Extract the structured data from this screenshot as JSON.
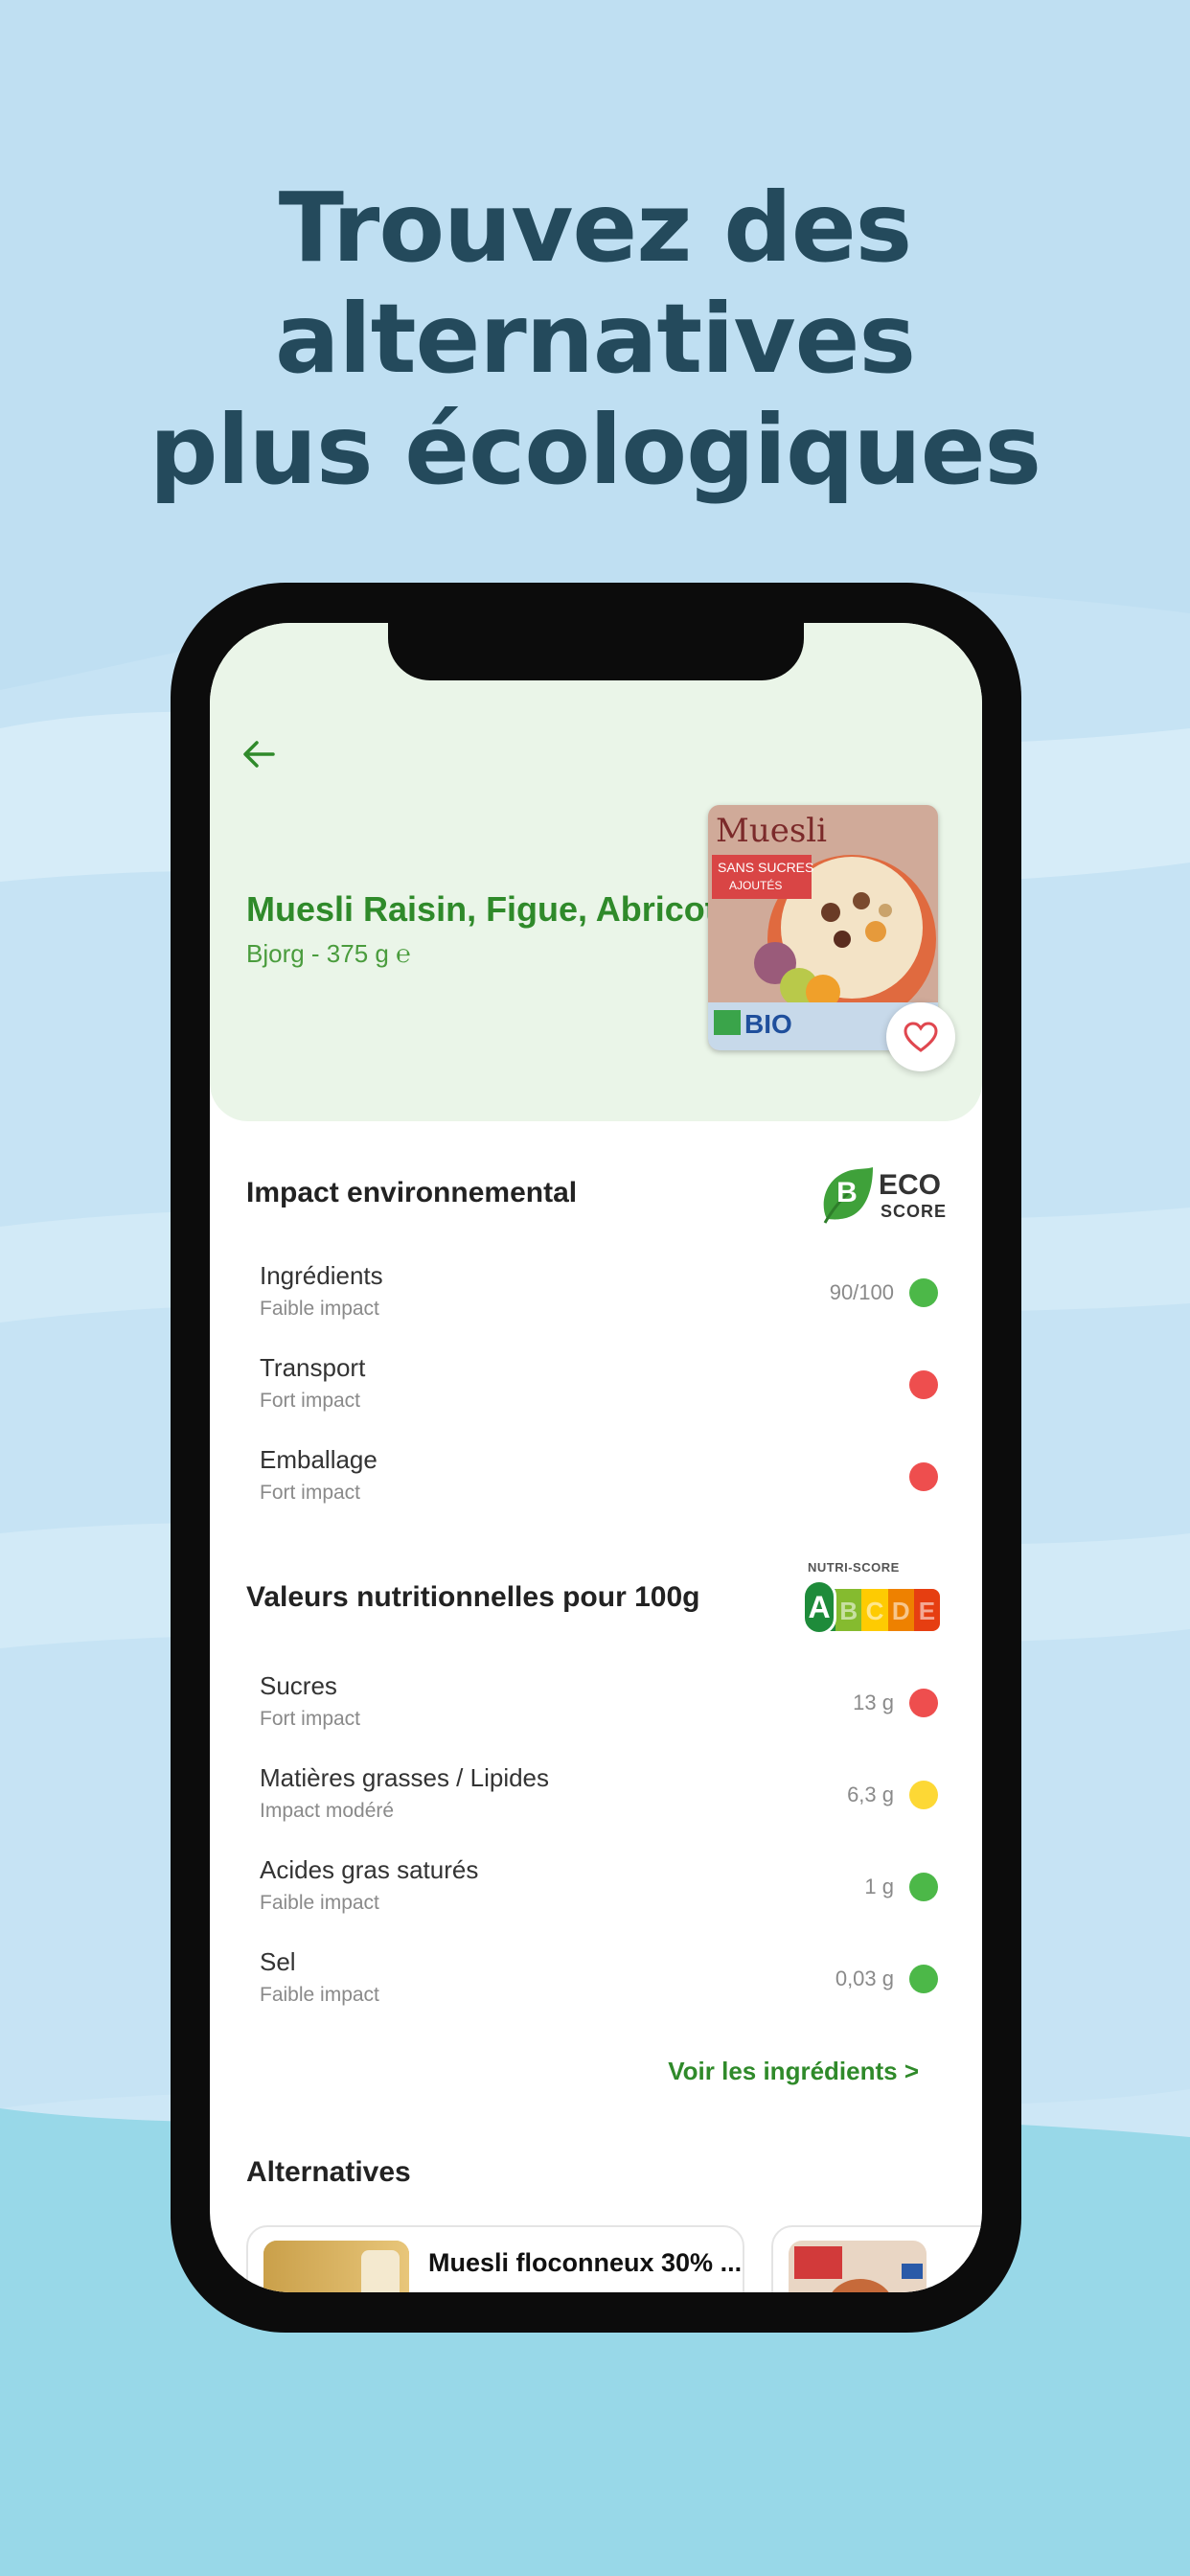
{
  "headline": {
    "line1": "Trouvez des alternatives",
    "line2": "plus écologiques"
  },
  "product": {
    "name": "Muesli Raisin, Figue, Abricot",
    "subtitle": "Bjorg - 375 g ℮",
    "package_text": {
      "brand": "Muesli",
      "banner_line1": "SANS SUCRES",
      "banner_line2": "AJOUTÉS",
      "label": "BIO"
    }
  },
  "eco_section": {
    "title": "Impact environnemental",
    "badge": {
      "grade": "B",
      "line1": "ECO",
      "line2": "SCORE"
    },
    "rows": [
      {
        "name": "Ingrédients",
        "desc": "Faible impact",
        "value": "90/100",
        "status": "good"
      },
      {
        "name": "Transport",
        "desc": "Fort impact",
        "value": "",
        "status": "bad"
      },
      {
        "name": "Emballage",
        "desc": "Fort impact",
        "value": "",
        "status": "bad"
      }
    ]
  },
  "nutri_section": {
    "title": "Valeurs nutritionnelles pour 100g",
    "badge": {
      "label": "NUTRI-SCORE",
      "grades": [
        "A",
        "B",
        "C",
        "D",
        "E"
      ],
      "selected": "A"
    },
    "rows": [
      {
        "name": "Sucres",
        "desc": "Fort impact",
        "value": "13 g",
        "status": "bad"
      },
      {
        "name": "Matières grasses / Lipides",
        "desc": "Impact modéré",
        "value": "6,3 g",
        "status": "medium"
      },
      {
        "name": "Acides gras saturés",
        "desc": "Faible impact",
        "value": "1 g",
        "status": "good"
      },
      {
        "name": "Sel",
        "desc": "Faible impact",
        "value": "0,03 g",
        "status": "good"
      }
    ]
  },
  "ingredients_link": "Voir les ingrédients >",
  "alternatives": {
    "title": "Alternatives",
    "items": [
      {
        "title": "Muesli floconneux 30% ..."
      },
      {
        "title": ""
      }
    ]
  },
  "colors": {
    "good": "#4cb848",
    "medium": "#fdd835",
    "bad": "#ee4e4e",
    "accent_green": "#2f8a2a",
    "headline": "#244a5c"
  },
  "icons": {
    "back": "arrow-left-icon",
    "favorite": "heart-icon",
    "eco": "leaf-icon"
  }
}
